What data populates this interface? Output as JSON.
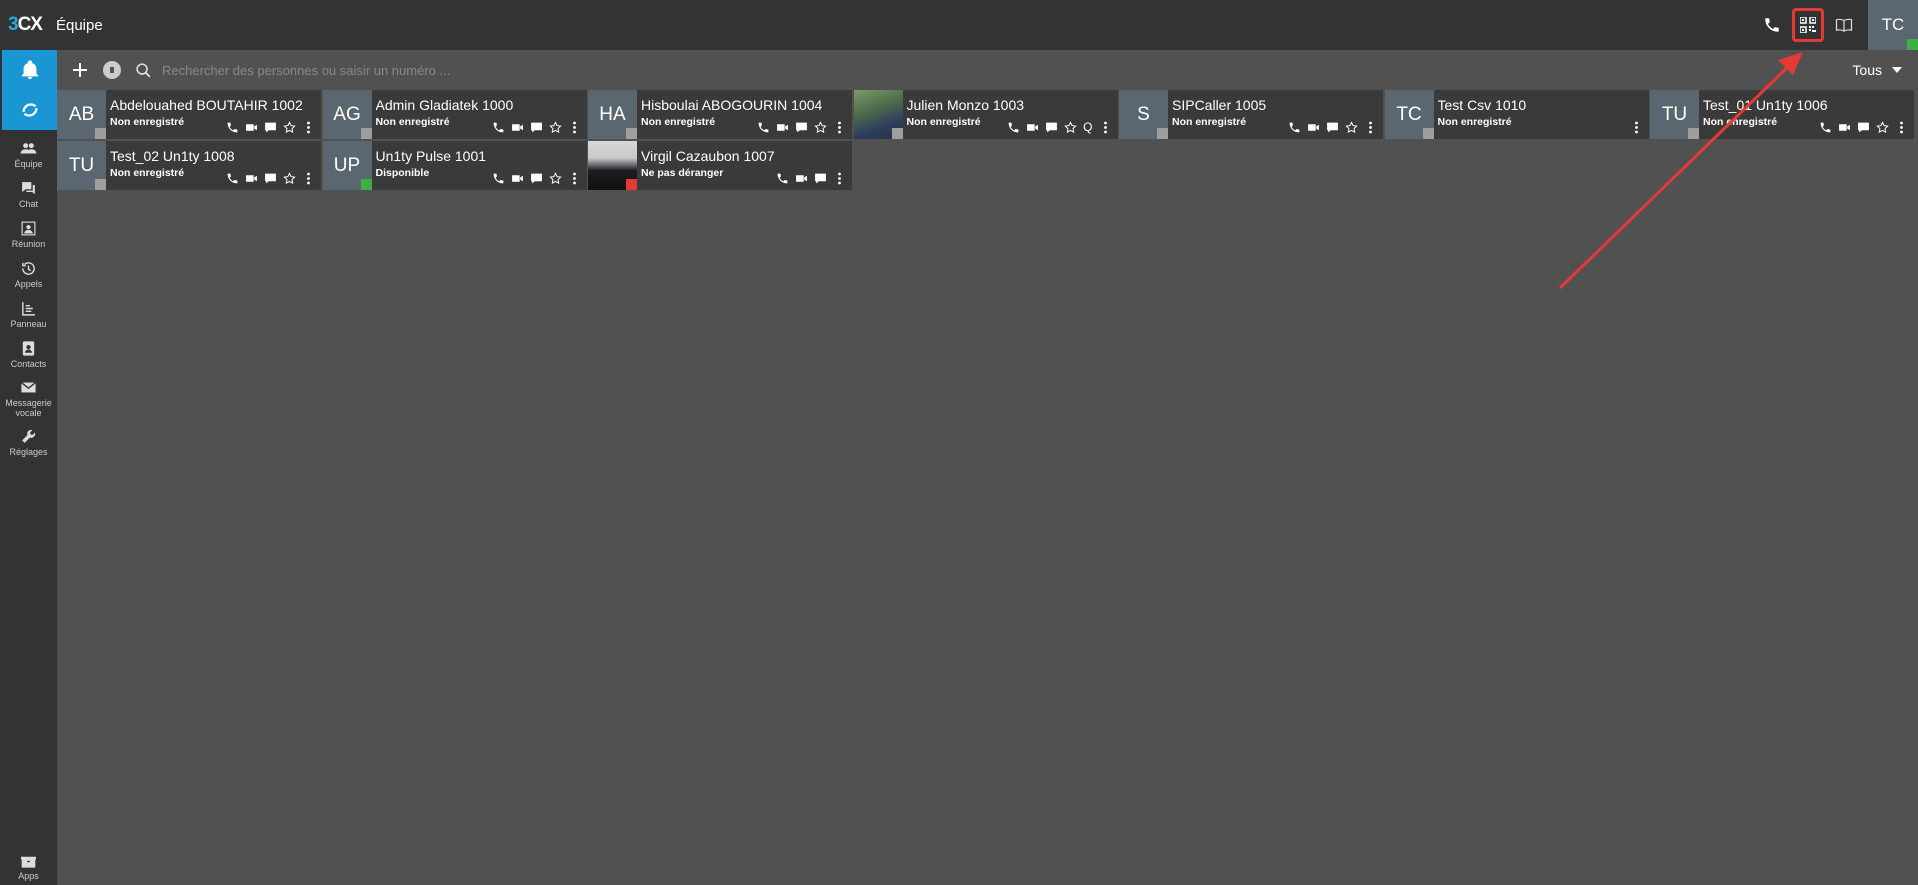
{
  "header": {
    "logo_three": "3",
    "logo_cx": "CX",
    "title": "Équipe",
    "user_initials": "TC"
  },
  "sidebar": {
    "items": [
      {
        "label": "Équipe",
        "icon": "team-icon"
      },
      {
        "label": "Chat",
        "icon": "chat-icon"
      },
      {
        "label": "Réunion",
        "icon": "meeting-icon"
      },
      {
        "label": "Appels",
        "icon": "history-icon"
      },
      {
        "label": "Panneau",
        "icon": "panel-icon"
      },
      {
        "label": "Contacts",
        "icon": "contacts-icon"
      },
      {
        "label": "Messagerie vocale",
        "icon": "voicemail-icon"
      },
      {
        "label": "Réglages",
        "icon": "wrench-icon"
      }
    ],
    "apps_label": "Apps"
  },
  "toolbar": {
    "search_placeholder": "Rechercher des personnes ou saisir un numéro ...",
    "scope": "Tous"
  },
  "colors": {
    "accent": "#1a96d4",
    "available": "#3cb043",
    "dnd": "#e53935",
    "offline": "#9e9e9e",
    "highlight": "#e53935"
  },
  "contacts": [
    {
      "initials": "AB",
      "name": "Abdelouahed BOUTAHIR 1002",
      "presence": "Non enregistré",
      "status": "grey"
    },
    {
      "initials": "AG",
      "name": "Admin Gladiatek 1000",
      "presence": "Non enregistré",
      "status": "grey"
    },
    {
      "initials": "HA",
      "name": "Hisboulai ABOGOURIN 1004",
      "presence": "Non enregistré",
      "status": "grey"
    },
    {
      "initials": "",
      "name": "Julien Monzo 1003",
      "presence": "Non enregistré",
      "status": "grey",
      "photo": "photo1",
      "extra": "Q"
    },
    {
      "initials": "S",
      "name": "SIPCaller 1005",
      "presence": "Non enregistré",
      "status": "grey"
    },
    {
      "initials": "TC",
      "name": "Test Csv 1010",
      "presence": "Non enregistré",
      "status": "grey",
      "menu_only": true
    },
    {
      "initials": "TU",
      "name": "Test_01 Un1ty 1006",
      "presence": "Non enregistré",
      "status": "grey"
    },
    {
      "initials": "TU",
      "name": "Test_02 Un1ty 1008",
      "presence": "Non enregistré",
      "status": "grey"
    },
    {
      "initials": "UP",
      "name": "Un1ty Pulse 1001",
      "presence": "Disponible",
      "status": "green"
    },
    {
      "initials": "",
      "name": "Virgil Cazaubon 1007",
      "presence": "Ne pas déranger",
      "status": "red",
      "photo": "photo2",
      "no_star": true
    }
  ]
}
